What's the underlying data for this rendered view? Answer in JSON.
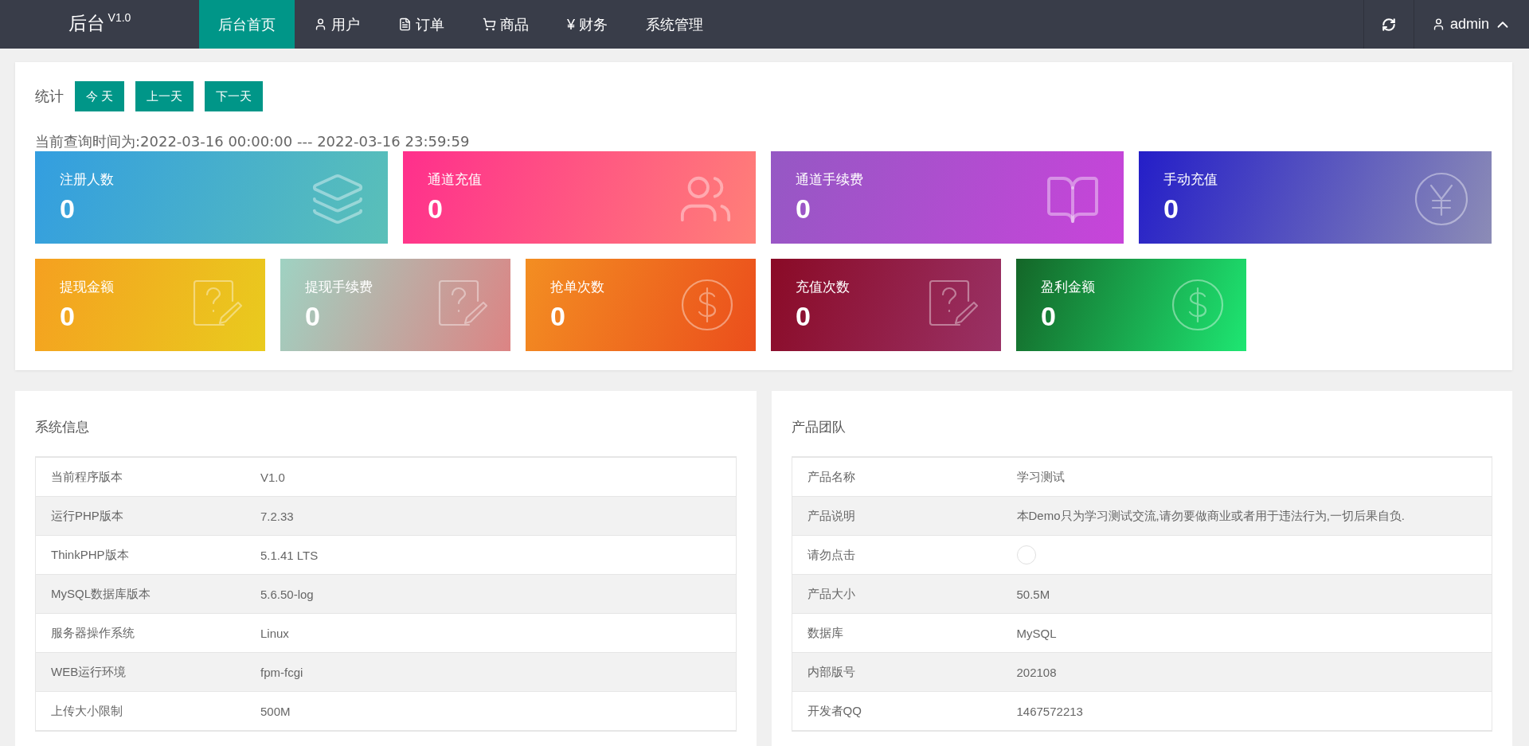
{
  "header": {
    "logo": "后台",
    "version": "V1.0",
    "nav": [
      {
        "label": "后台首页",
        "selected": true
      },
      {
        "label": "用户",
        "selected": false
      },
      {
        "label": "订单",
        "selected": false
      },
      {
        "label": "商品",
        "selected": false
      },
      {
        "label": "¥",
        "label2": "财务",
        "selected": false
      },
      {
        "label": "系统管理",
        "selected": false
      }
    ],
    "user": "admin"
  },
  "stats": {
    "title": "统计",
    "buttons": [
      "今 天",
      "上一天",
      "下一天"
    ],
    "query": "当前查询时间为:2022-03-16 00:00:00 --- 2022-03-16 23:59:59",
    "cards_row_1": [
      {
        "label": "注册人数",
        "value": "0"
      },
      {
        "label": "通道充值",
        "value": "0"
      },
      {
        "label": "通道手续费",
        "value": "0"
      },
      {
        "label": "手动充值",
        "value": "0"
      }
    ],
    "cards_row_2": [
      {
        "label": "提现金额",
        "value": "0"
      },
      {
        "label": "提现手续费",
        "value": "0"
      },
      {
        "label": "抢单次数",
        "value": "0"
      },
      {
        "label": "充值次数",
        "value": "0"
      },
      {
        "label": "盈利金额",
        "value": "0"
      }
    ]
  },
  "system_info": {
    "title": "系统信息",
    "rows": [
      {
        "kind": "text",
        "label": "当前程序版本",
        "value": "V1.0"
      },
      {
        "kind": "text",
        "label": "运行PHP版本",
        "value": "7.2.33"
      },
      {
        "kind": "text",
        "label": "ThinkPHP版本",
        "value": "5.1.41 LTS"
      },
      {
        "kind": "text",
        "label": "MySQL数据库版本",
        "value": "5.6.50-log"
      },
      {
        "kind": "text",
        "label": "服务器操作系统",
        "value": "Linux"
      },
      {
        "kind": "text",
        "label": "WEB运行环境",
        "value": "fpm-fcgi"
      },
      {
        "kind": "text",
        "label": "上传大小限制",
        "value": "500M"
      }
    ]
  },
  "product_team": {
    "title": "产品团队",
    "rows": [
      {
        "kind": "text",
        "label": "产品名称",
        "value": "学习测试"
      },
      {
        "kind": "text",
        "label": "产品说明",
        "value": "本Demo只为学习测试交流,请勿要做商业或者用于违法行为,一切后果自负."
      },
      {
        "kind": "icon",
        "label": "请勿点击"
      },
      {
        "kind": "text",
        "label": "产品大小",
        "value": "50.5M"
      },
      {
        "kind": "text",
        "label": "数据库",
        "value": "MySQL"
      },
      {
        "kind": "text",
        "label": "内部版号",
        "value": "202108"
      },
      {
        "kind": "text",
        "label": "开发者QQ",
        "value": "1467572213"
      }
    ]
  }
}
